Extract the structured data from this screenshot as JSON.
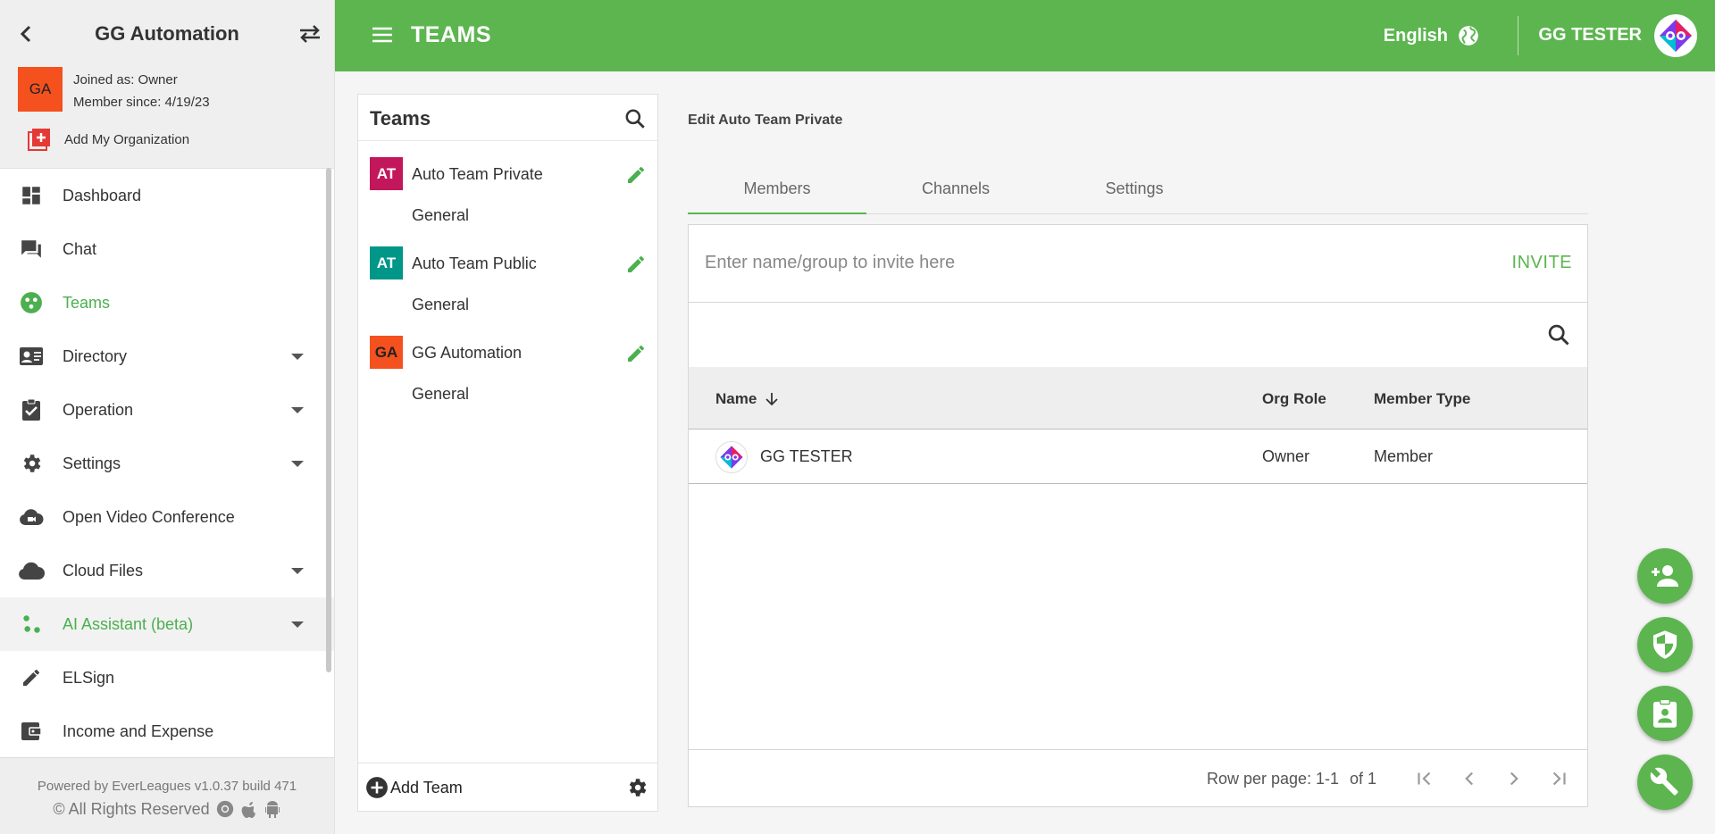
{
  "sidebar": {
    "org_name": "GG Automation",
    "org_avatar": "GA",
    "joined_as": "Joined as: Owner",
    "member_since": "Member since: 4/19/23",
    "add_org_label": "Add My Organization",
    "nav": [
      {
        "label": "Dashboard",
        "icon": "dashboard-icon"
      },
      {
        "label": "Chat",
        "icon": "chat-icon"
      },
      {
        "label": "Teams",
        "icon": "teams-icon",
        "active": true
      },
      {
        "label": "Directory",
        "icon": "contact-card-icon",
        "expand": true
      },
      {
        "label": "Operation",
        "icon": "assignment-check-icon",
        "expand": true
      },
      {
        "label": "Settings",
        "icon": "gear-icon",
        "expand": true
      },
      {
        "label": "Open Video Conference",
        "icon": "cloud-video-icon"
      },
      {
        "label": "Cloud Files",
        "icon": "cloud-icon",
        "expand": true
      },
      {
        "label": "AI Assistant (beta)",
        "icon": "ai-dots-icon",
        "expand": true
      },
      {
        "label": "ELSign",
        "icon": "pen-icon"
      },
      {
        "label": "Income and Expense",
        "icon": "wallet-icon"
      }
    ],
    "footer_powered": "Powered by EverLeagues v1.0.37 build 471",
    "footer_rights": "© All Rights Reserved"
  },
  "header": {
    "title": "TEAMS",
    "language": "English",
    "user_name": "GG TESTER",
    "accent_color": "#5cb54f"
  },
  "teams_panel": {
    "title": "Teams",
    "teams": [
      {
        "avatar": "AT",
        "color": "#c2185b",
        "name": "Auto Team Private",
        "channel": "General"
      },
      {
        "avatar": "AT",
        "color": "#009688",
        "name": "Auto Team Public",
        "channel": "General"
      },
      {
        "avatar": "GA",
        "color": "#f4511e",
        "name": "GG Automation",
        "channel": "General"
      }
    ],
    "add_team_label": "Add Team"
  },
  "main": {
    "edit_title": "Edit Auto Team Private",
    "tabs": [
      "Members",
      "Channels",
      "Settings"
    ],
    "active_tab": "Members",
    "invite_placeholder": "Enter name/group to invite here",
    "invite_value": "",
    "invite_label": "INVITE",
    "columns": {
      "name": "Name",
      "org_role": "Org Role",
      "member_type": "Member Type"
    },
    "members": [
      {
        "name": "GG TESTER",
        "org_role": "Owner",
        "member_type": "Member"
      }
    ],
    "pagination": {
      "rows_label": "Row per page:",
      "range": "1-1",
      "of": "of 1"
    }
  }
}
